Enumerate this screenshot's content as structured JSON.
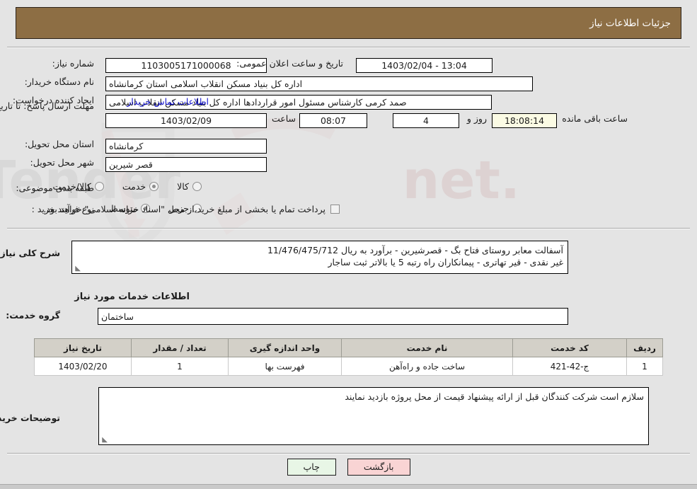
{
  "header": {
    "title": "جزئیات اطلاعات نیاز"
  },
  "fields": {
    "need_number_label": "شماره نیاز:",
    "need_number_value": "1103005171000068",
    "announce_label": "تاریخ و ساعت اعلان عمومی:",
    "announce_value": "13:04 - 1403/02/04",
    "buyer_org_label": "نام دستگاه خریدار:",
    "buyer_org_value": "اداره کل بنیاد مسکن انقلاب اسلامی استان کرمانشاه",
    "requester_label": "ایجاد کننده درخواست:",
    "requester_value": "صمد کرمی کارشناس مسئول امور قراردادها اداره کل بنیاد مسکن انقلاب اسلامی",
    "contact_link": "اطلاعات تماس خریدار",
    "deadline_label": "مهلت ارسال پاسخ: تا تاریخ:",
    "deadline_date": "1403/02/09",
    "deadline_hour_label": "ساعت",
    "deadline_hour": "08:07",
    "remaining_days": "4",
    "remaining_days_label": "روز و",
    "remaining_time": "18:08:14",
    "remaining_suffix": "ساعت باقی مانده",
    "province_label": "استان محل تحویل:",
    "province_value": "کرمانشاه",
    "city_label": "شهر محل تحویل:",
    "city_value": "قصر شیرین"
  },
  "classification": {
    "label": "طبقه بندی موضوعی:",
    "options": [
      {
        "label": "کالا",
        "selected": false
      },
      {
        "label": "خدمت",
        "selected": true
      },
      {
        "label": "کالا/خدمت",
        "selected": false
      }
    ]
  },
  "process_type": {
    "label": "نوع فرآیند خرید :",
    "options": [
      {
        "label": "جزیی",
        "selected": false
      },
      {
        "label": "متوسط",
        "selected": true
      }
    ],
    "checkbox_label": "پرداخت تمام یا بخشی از مبلغ خرید،از محل \"اسناد خزانه اسلامی\" خواهد بود.",
    "checkbox_checked": false
  },
  "summary": {
    "label": "شرح کلی نیاز:",
    "line1": "آسفالت معابر روستای فتاح بگ - قصرشیرین - برآورد به ریال  11/476/475/712",
    "line2": "غیر نقدی - قیر تهاتری - پیمانکاران راه رتبه 5 یا بالاتر ثبت ساجار"
  },
  "services_section": {
    "heading": "اطلاعات خدمات مورد نیاز",
    "group_label": "گروه خدمت:",
    "group_value": "ساختمان",
    "columns": [
      "ردیف",
      "کد خدمت",
      "نام خدمت",
      "واحد اندازه گیری",
      "تعداد / مقدار",
      "تاریخ نیاز"
    ],
    "rows": [
      {
        "index": "1",
        "code": "ج-42-421",
        "name": "ساخت جاده و راه‌آهن",
        "unit": "فهرست بها",
        "quantity": "1",
        "need_date": "1403/02/20"
      }
    ]
  },
  "buyer_notes": {
    "label": "توضیحات خریدار:",
    "text": "سلازم است شرکت کنندگان قبل از ارائه پیشنهاد قیمت از محل پروژه بازدید نمایند"
  },
  "buttons": {
    "print": "چاپ",
    "back": "بازگشت"
  },
  "watermark": {
    "text": "AriaTender.net"
  },
  "colors": {
    "header_bg": "#8d6e44",
    "page_bg": "#e4e4e4",
    "link": "#1111cc",
    "table_header_bg": "#d3d0c8",
    "back_button_bg": "#f9d4d4",
    "print_button_bg": "#e8f6e6",
    "highlight_field_bg": "#fbfbe4"
  }
}
